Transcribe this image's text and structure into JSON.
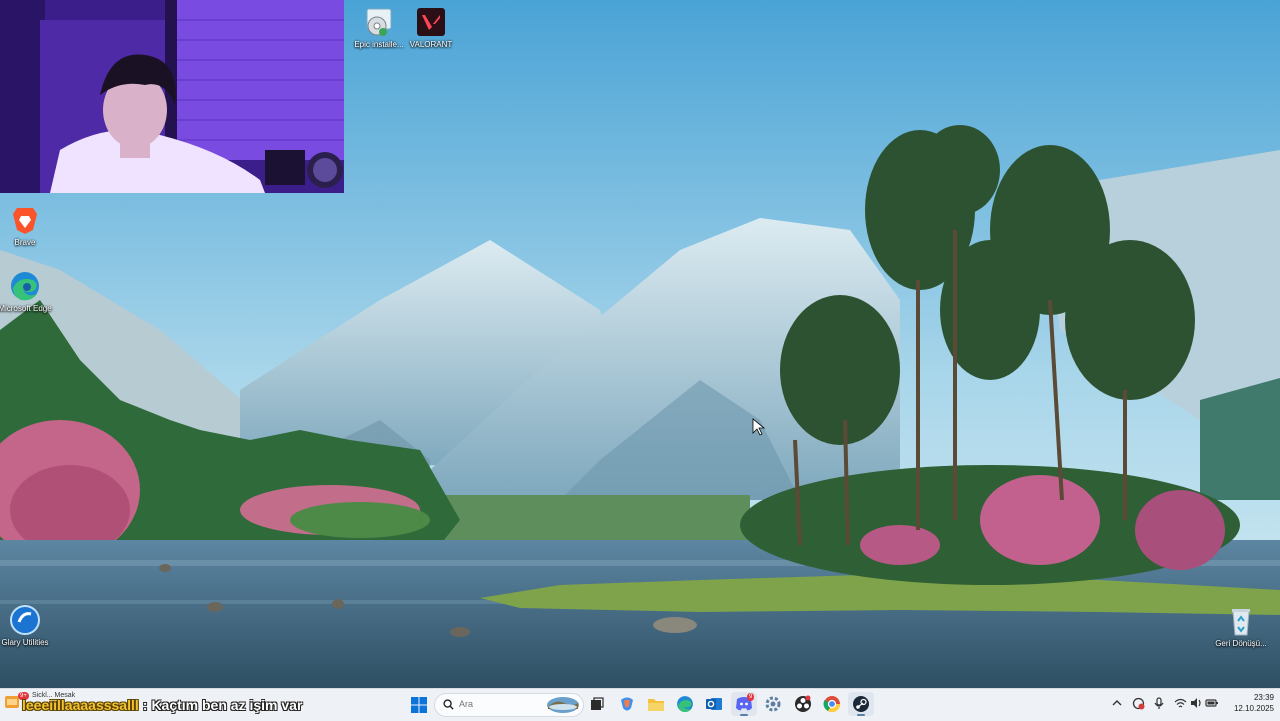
{
  "desktop": {
    "icons": [
      {
        "name": "Epic installe...",
        "icon": "epic-installer-icon"
      },
      {
        "name": "VALORANT",
        "icon": "valorant-icon"
      },
      {
        "name": "Brave",
        "icon": "brave-icon"
      },
      {
        "name": "Microsoft Edge",
        "icon": "edge-icon"
      },
      {
        "name": "Glary Utilities",
        "icon": "glary-utilities-icon"
      },
      {
        "name": "Geri Dönüşü...",
        "icon": "recycle-bin-icon"
      }
    ]
  },
  "chat_overlay": {
    "username": "leeeiillaaaasssalll",
    "separator": ":",
    "message": "Kaçtım ben az işim var"
  },
  "taskbar": {
    "search_placeholder": "Ara",
    "notification_badge": "9+",
    "notification_text": "Sickl... Mesak",
    "pinned": [
      "windows-start-icon",
      "search-icon",
      "widget-icon",
      "task-view-icon",
      "copilot-icon",
      "file-explorer-icon",
      "edge-icon",
      "outlook-icon",
      "discord-icon",
      "settings-icon",
      "obs-icon",
      "chrome-icon",
      "steam-icon"
    ],
    "discord_badge": "9"
  },
  "tray": {
    "icons": [
      "chevron-up-icon",
      "antivirus-icon",
      "microphone-icon",
      "speaker-icon",
      "wifi-icon",
      "battery-icon"
    ],
    "time": "23:39",
    "date": "12.10.2025"
  },
  "colors": {
    "taskbar_bg": "#eef1f5",
    "chat_username": "#f2c232",
    "chat_message": "#ffffff",
    "sky": "#5aa9d6"
  }
}
